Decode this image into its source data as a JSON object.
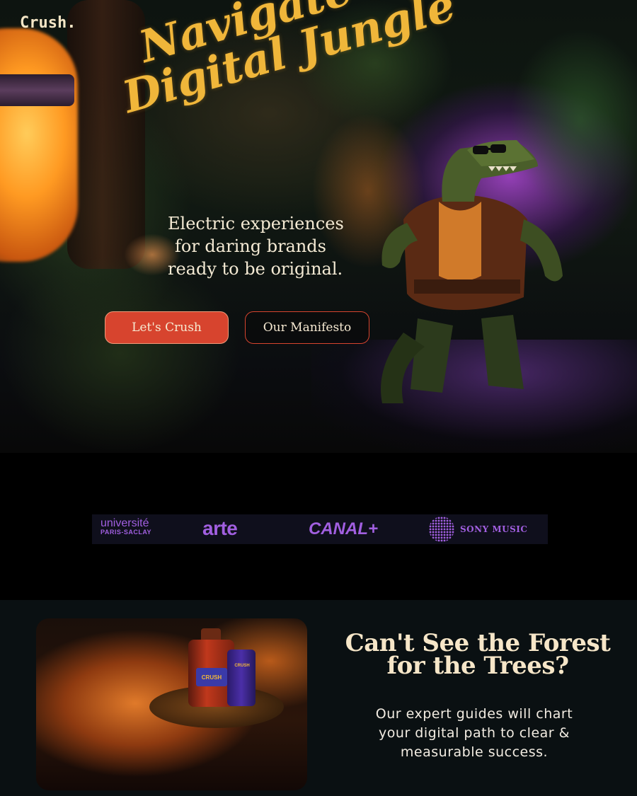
{
  "brand": {
    "logo": "Crush."
  },
  "hero": {
    "headline_line1": "Navigate the",
    "headline_line2": "Digital Jungle",
    "subhead_lines": [
      "Electric experiences",
      "for daring brands",
      "ready to be original."
    ],
    "primary_button": "Let's Crush",
    "secondary_button": "Our Manifesto"
  },
  "partners": {
    "universite_main": "université",
    "universite_sub": "PARIS-SACLAY",
    "arte": "arte",
    "canal": "CANAL+",
    "sony": "SONY MUSIC"
  },
  "section2": {
    "title_line1": "Can't See the Forest",
    "title_line2": "for the Trees?",
    "body_lines": [
      "Our expert guides will chart",
      "your digital path to clear &",
      "measurable success."
    ],
    "bottle_label": "CRUSH",
    "bottle_label_small": "CRUSH"
  },
  "colors": {
    "accent": "#d7442e",
    "gold": "#f0b63a",
    "partner_purple": "#a15fe0",
    "cream": "#f6e6c8"
  }
}
